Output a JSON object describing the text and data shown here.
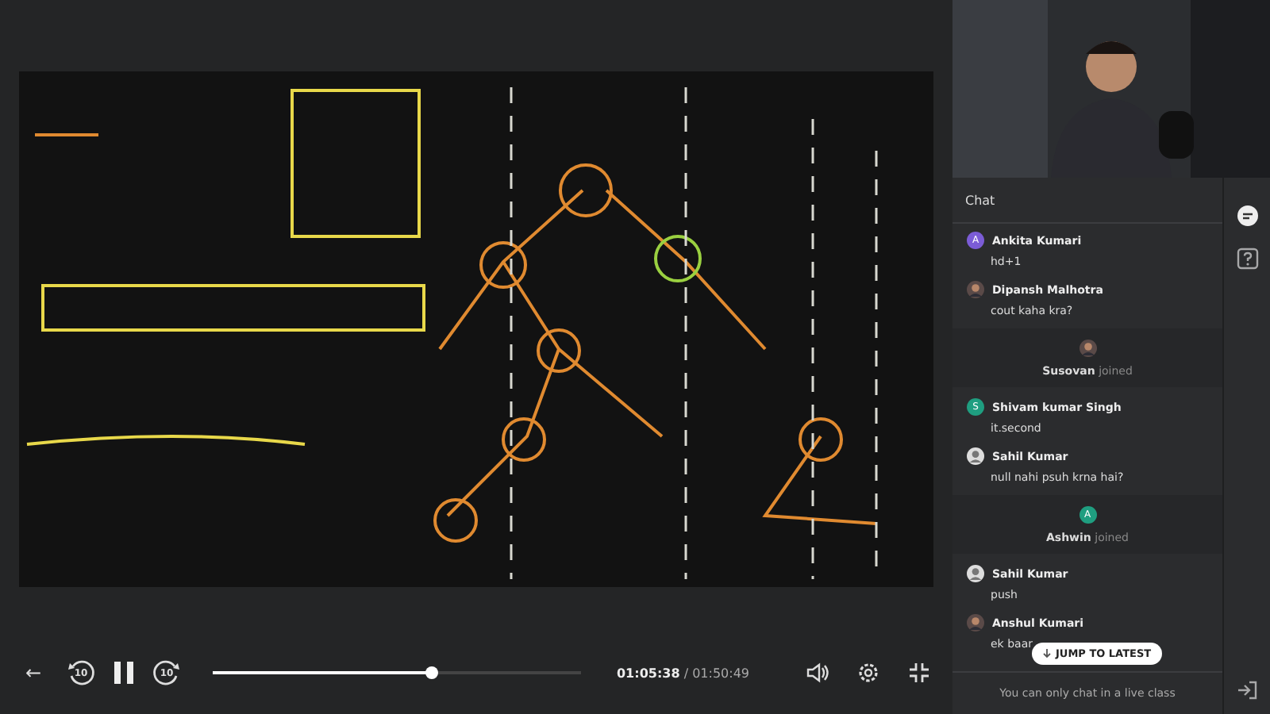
{
  "player": {
    "controls": {
      "back_icon": "←",
      "skip_back": "10",
      "playing": true,
      "skip_forward": "10",
      "progress": {
        "level": 0.593
      },
      "current_time": "01:05:38",
      "total_time": "/ 01:50:49"
    }
  },
  "sidebar": {
    "chat": {
      "title": "Chat",
      "messages": [
        {
          "kind": "message",
          "author": "Ankita Kumari",
          "text": "hd+1",
          "avatar": {
            "kind": "letter",
            "letter": "A",
            "color": "#7b5cd6"
          }
        },
        {
          "kind": "message",
          "author": "Dipansh Malhotra",
          "text": "cout kaha kra?"
        },
        {
          "kind": "join",
          "author": "Susovan",
          "text": "joined"
        },
        {
          "kind": "message",
          "author": "Shivam kumar Singh",
          "text": "it.second",
          "avatar": {
            "kind": "letter",
            "letter": "S",
            "color": "#1f9e80"
          }
        },
        {
          "kind": "message",
          "author": "Sahil Kumar",
          "text": "null nahi psuh krna hai?",
          "avatar": {
            "kind": "user"
          }
        },
        {
          "kind": "join",
          "author": "Ashwin",
          "text": "joined",
          "avatar": {
            "kind": "letter",
            "letter": "A",
            "color": "#1f9e80"
          }
        },
        {
          "kind": "message",
          "author": "Sahil Kumar",
          "text": "push",
          "avatar": {
            "kind": "user"
          }
        },
        {
          "kind": "message",
          "author": "Anshul Kumari",
          "text": "ek baar"
        }
      ],
      "jump_button": "JUMP TO LATEST",
      "footer": "You can only chat in a live class"
    },
    "rail": [
      {
        "kind": "chat",
        "selected": true
      },
      {
        "kind": "help",
        "selected": false
      },
      {
        "kind": "exit",
        "selected": false
      }
    ]
  }
}
